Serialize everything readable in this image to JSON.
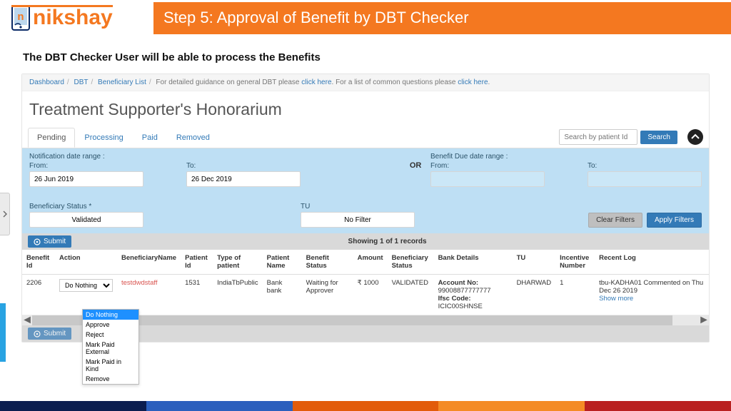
{
  "brand": {
    "name": "nikshay"
  },
  "step_banner": "Step 5: Approval of  Benefit by DBT Checker",
  "subtitle": "The DBT Checker User will be able to process the Benefits",
  "breadcrumb": {
    "dashboard": "Dashboard",
    "dbt": "DBT",
    "beneficiary_list": "Beneficiary List",
    "guidance_prefix": "For detailed guidance on general DBT please ",
    "click_here": "click here",
    "faq_prefix": ". For a list of common questions please ",
    "faq_link": "click here",
    "period": "."
  },
  "page_title": "Treatment Supporter's Honorarium",
  "tabs": {
    "pending": "Pending",
    "processing": "Processing",
    "paid": "Paid",
    "removed": "Removed"
  },
  "search": {
    "placeholder": "Search by patient Id",
    "button": "Search"
  },
  "filters": {
    "notif_label": "Notification date range :",
    "from_label": "From:",
    "to_label": "To:",
    "from_value": "26 Jun 2019",
    "to_value": "26 Dec 2019",
    "or": "OR",
    "due_label": "Benefit Due date range :",
    "due_from": "",
    "due_to": "",
    "benef_status_label": "Beneficiary Status *",
    "benef_status_value": "Validated",
    "tu_label": "TU",
    "tu_value": "No Filter",
    "clear": "Clear Filters",
    "apply": "Apply Filters"
  },
  "submit": "Submit",
  "records_text": "Showing 1 of 1 records",
  "columns": {
    "benefit_id": "Benefit Id",
    "action": "Action",
    "beneficiary_name": "BeneficiaryName",
    "patient_id": "Patient Id",
    "type_patient": "Type of patient",
    "patient_name": "Patient Name",
    "benefit_status": "Benefit Status",
    "amount": "Amount",
    "beneficiary_status": "Beneficiary Status",
    "bank_details": "Bank Details",
    "tu": "TU",
    "incentive_number": "Incentive Number",
    "recent_log": "Recent Log"
  },
  "row": {
    "benefit_id": "2206",
    "action_selected": "Do Nothing",
    "beneficiary_name": "testdwdstaff",
    "patient_id": "1531",
    "type_patient": "IndiaTbPublic",
    "patient_name": "Bank bank",
    "benefit_status": "Waiting for Approver",
    "amount": "₹ 1000",
    "beneficiary_status": "VALIDATED",
    "bank_acct_label": "Account No:",
    "bank_acct": "99008877777777",
    "bank_ifsc_label": "Ifsc Code:",
    "bank_ifsc": "ICIC00SHNSE",
    "tu": "DHARWAD",
    "incentive_number": "1",
    "recent_log": "tbu-KADHA01 Commented on Thu Dec 26 2019",
    "show_more": "Show more"
  },
  "action_options": {
    "do_nothing": "Do Nothing",
    "approve": "Approve",
    "reject": "Reject",
    "mark_paid_external": "Mark Paid External",
    "mark_paid_kind": "Mark Paid in Kind",
    "remove": "Remove"
  }
}
